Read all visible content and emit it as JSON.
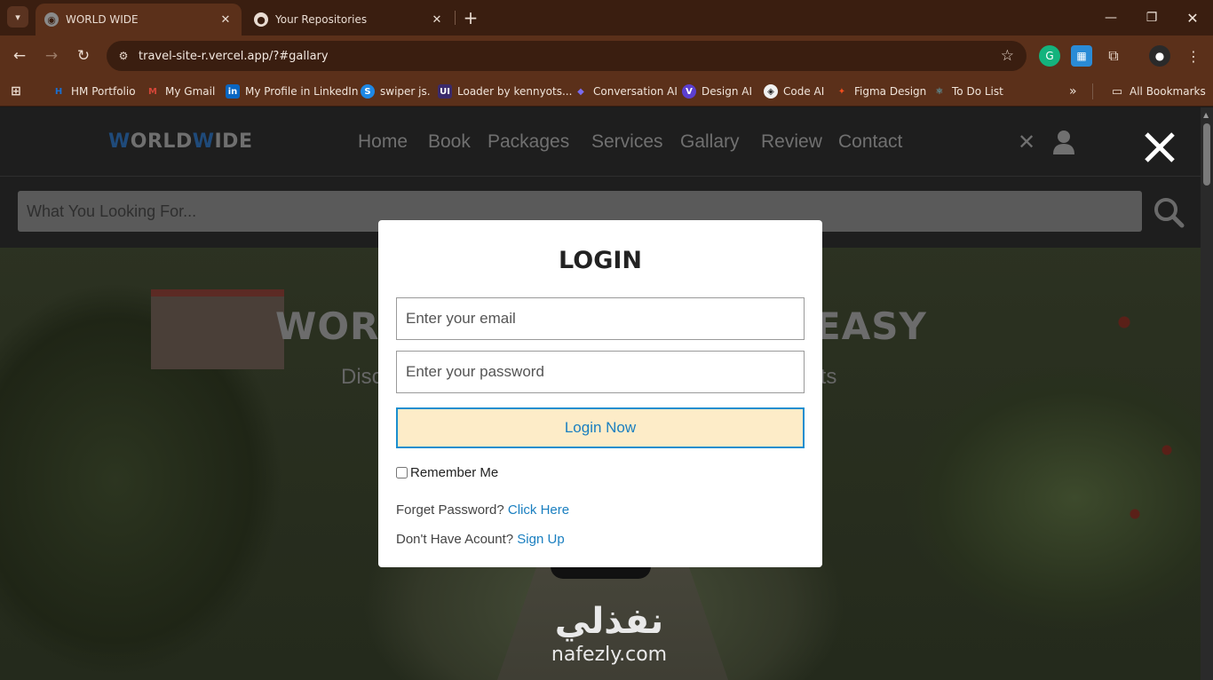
{
  "browser": {
    "tabs": [
      {
        "title": "WORLD WIDE",
        "active": true
      },
      {
        "title": "Your Repositories",
        "active": false
      }
    ],
    "url": "travel-site-r.vercel.app/?#gallary",
    "bookmarks": [
      {
        "label": "HM Portfolio",
        "icon": "hm-icon",
        "color": "#1a6fd0"
      },
      {
        "label": "My Gmail",
        "icon": "gmail-icon",
        "color": "#d44638"
      },
      {
        "label": "My Profile in LinkedIn",
        "icon": "linkedin-icon",
        "color": "#0a66c2"
      },
      {
        "label": "swiper js.",
        "icon": "swiper-icon",
        "color": "#1e88e5"
      },
      {
        "label": "Loader by kennyots...",
        "icon": "uiverse-icon",
        "color": "#3b2a6b"
      },
      {
        "label": "Conversation AI",
        "icon": "conversation-ai-icon",
        "color": "#7a6cf0"
      },
      {
        "label": "Design AI",
        "icon": "design-ai-icon",
        "color": "#5b3fd0"
      },
      {
        "label": "Code AI",
        "icon": "code-ai-icon",
        "color": "#222222"
      },
      {
        "label": "Figma Design",
        "icon": "figma-icon",
        "color": "#f24e1e"
      },
      {
        "label": "To Do List",
        "icon": "react-icon",
        "color": "#61dafb"
      }
    ],
    "all_bookmarks": "All Bookmarks"
  },
  "site": {
    "logo": {
      "w1": "W",
      "rest1": "ORLD",
      "w2": "W",
      "rest2": "IDE"
    },
    "menu": [
      "Home",
      "Book",
      "Packages",
      "Services",
      "Gallary",
      "Review",
      "Contact"
    ],
    "search_placeholder": "What You Looking For...",
    "hero_title_left": "WORL",
    "hero_title_right": "EASY",
    "hero_sub_left": "Disc",
    "hero_sub_right": "aits"
  },
  "login": {
    "title": "LOGIN",
    "email_placeholder": "Enter your email",
    "password_placeholder": "Enter your password",
    "button": "Login Now",
    "remember": "Remember Me",
    "forgot_text": "Forget Password?",
    "forgot_link": "Click Here",
    "signup_text": "Don't Have Acount?",
    "signup_link": "Sign Up"
  },
  "watermark": {
    "arabic": "نفذلي",
    "latin": "nafezly.com"
  },
  "colors": {
    "accent": "#1a7fc0",
    "button_bg": "#fdecc8",
    "chrome": "#5b301a"
  }
}
